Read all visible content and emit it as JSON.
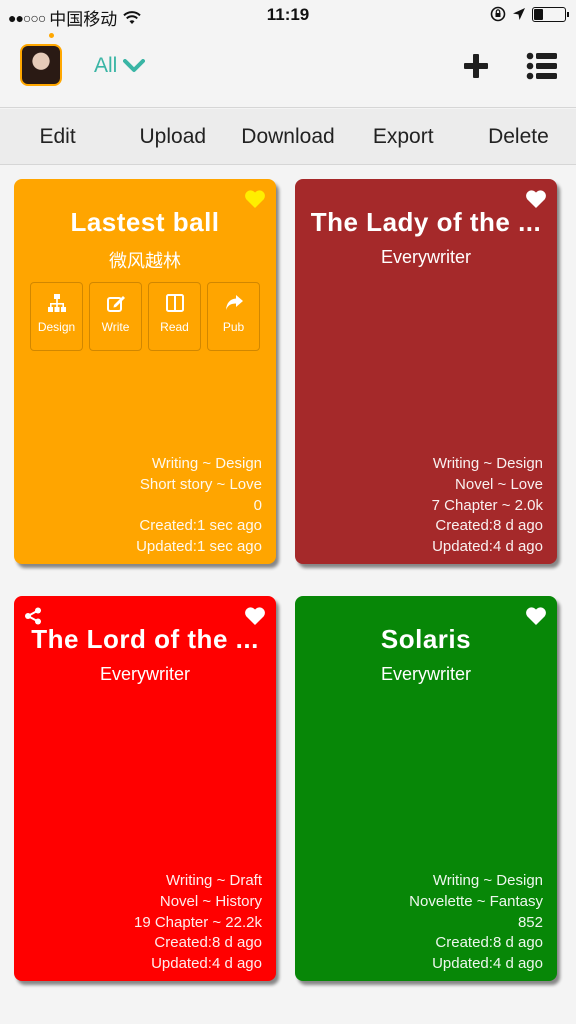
{
  "status_bar": {
    "signal": "●●○○○",
    "carrier": "中国移动",
    "time": "11:19"
  },
  "nav": {
    "filter_label": "All",
    "icons": [
      "avatar",
      "chevron-down-icon",
      "plus-icon",
      "list-icon"
    ]
  },
  "toolbar": {
    "edit": "Edit",
    "upload": "Upload",
    "download": "Download",
    "export": "Export",
    "delete": "Delete"
  },
  "books": [
    {
      "title": "Lastest ball",
      "author": "微风越林",
      "color": "#ffa500",
      "heart_color": "#ffee00",
      "shared": false,
      "actions": [
        "Design",
        "Write",
        "Read",
        "Pub"
      ],
      "meta": [
        "Writing ~ Design",
        "Short story ~ Love",
        "0",
        "Created:1 sec ago",
        "Updated:1 sec ago"
      ]
    },
    {
      "title": "The Lady of the ...",
      "author": "Everywriter",
      "color": "#a5292a",
      "heart_color": "#ffffff",
      "shared": false,
      "meta": [
        "Writing ~ Design",
        "Novel ~ Love",
        "7 Chapter ~ 2.0k",
        "Created:8 d ago",
        "Updated:4 d ago"
      ]
    },
    {
      "title": "The Lord of the ...",
      "author": "Everywriter",
      "color": "#ff0000",
      "heart_color": "#ffffff",
      "shared": true,
      "meta": [
        "Writing ~ Draft",
        "Novel ~ History",
        "19 Chapter ~ 22.2k",
        "Created:8 d ago",
        "Updated:4 d ago"
      ]
    },
    {
      "title": "Solaris",
      "author": "Everywriter",
      "color": "#078707",
      "heart_color": "#ffffff",
      "shared": false,
      "meta": [
        "Writing ~ Design",
        "Novelette ~ Fantasy",
        "852",
        "Created:8 d ago",
        "Updated:4 d ago"
      ]
    }
  ]
}
